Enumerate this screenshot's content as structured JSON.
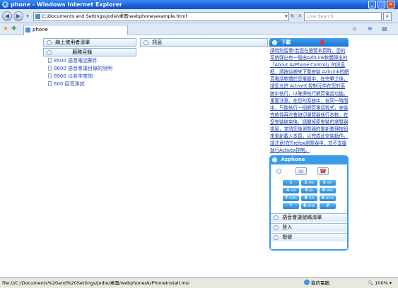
{
  "window": {
    "title": "phone - Windows Internet Explorer"
  },
  "toolbar": {
    "address": "C:\\Documents and Settings\\Jodie\\桌面\\webphone\\example.html",
    "search_placeholder": "Live Search"
  },
  "tabs": [
    {
      "label": "phone"
    }
  ],
  "page": {
    "left_header": "線上使用者清單",
    "list_header": "服務目錄",
    "list_items": [
      {
        "label": "8500 語音電話郵件"
      },
      {
        "label": "8600 語音會議目錄的說明"
      },
      {
        "label": "8900 以名字查詢"
      },
      {
        "label": "600 回音測試"
      }
    ],
    "messages_header": "訊息",
    "download_header": "下載",
    "download_text": "請特別留意!若您在瀏覽本頁時，您的系統彈出有一個由AzbLink軟體彈出的「About AzPhone Control」的訊息框，請按這裡來下載安裝 AzbLink的網頁電話軟體於您電腦中，在完畢之後，請您允許 ActiveX 控制元件在您的系統中執行，以確保執行網頁電話功能。重要注意，在您的系統中，在同一時間中，只能執行一個網頁電話程式，安裝完軟件再次會迫切瀏覽器執行本軟，在您安裝結束後，請關掉原安裝的瀏覽器視窗，並請您後瀏覽器的重新整理按鈕來重新載入本頁。以完成此安裝動作。請注意!在Firefox瀏覽器中，並不支援執行Activex控制。"
  },
  "azphone": {
    "title": "Azphone",
    "keys": [
      {
        "digit": "1",
        "letters": ""
      },
      {
        "digit": "2",
        "letters": "ABC"
      },
      {
        "digit": "3",
        "letters": "DEF"
      },
      {
        "digit": "4",
        "letters": "GHI"
      },
      {
        "digit": "5",
        "letters": "JKL"
      },
      {
        "digit": "6",
        "letters": "MNO"
      },
      {
        "digit": "7",
        "letters": "PQRS"
      },
      {
        "digit": "8",
        "letters": "TUV"
      },
      {
        "digit": "9",
        "letters": "WXYZ"
      },
      {
        "digit": "*",
        "letters": ""
      },
      {
        "digit": "0",
        "letters": "OPER"
      },
      {
        "digit": "#",
        "letters": ""
      }
    ],
    "menu": [
      {
        "label": "語音會議號碼清單"
      },
      {
        "label": "登入"
      },
      {
        "label": "撥號"
      }
    ]
  },
  "statusbar": {
    "url": "file:///C:/Documents%20and%20Settings/Jodie/桌面/webphone/AzPhoneInstall.msi",
    "zone": "我的電腦",
    "zoom": "100%"
  },
  "colors": {
    "ie_title": "#1b5fd8",
    "azphone_blue": "#3a9be8",
    "link_blue": "#1a3ea8"
  }
}
